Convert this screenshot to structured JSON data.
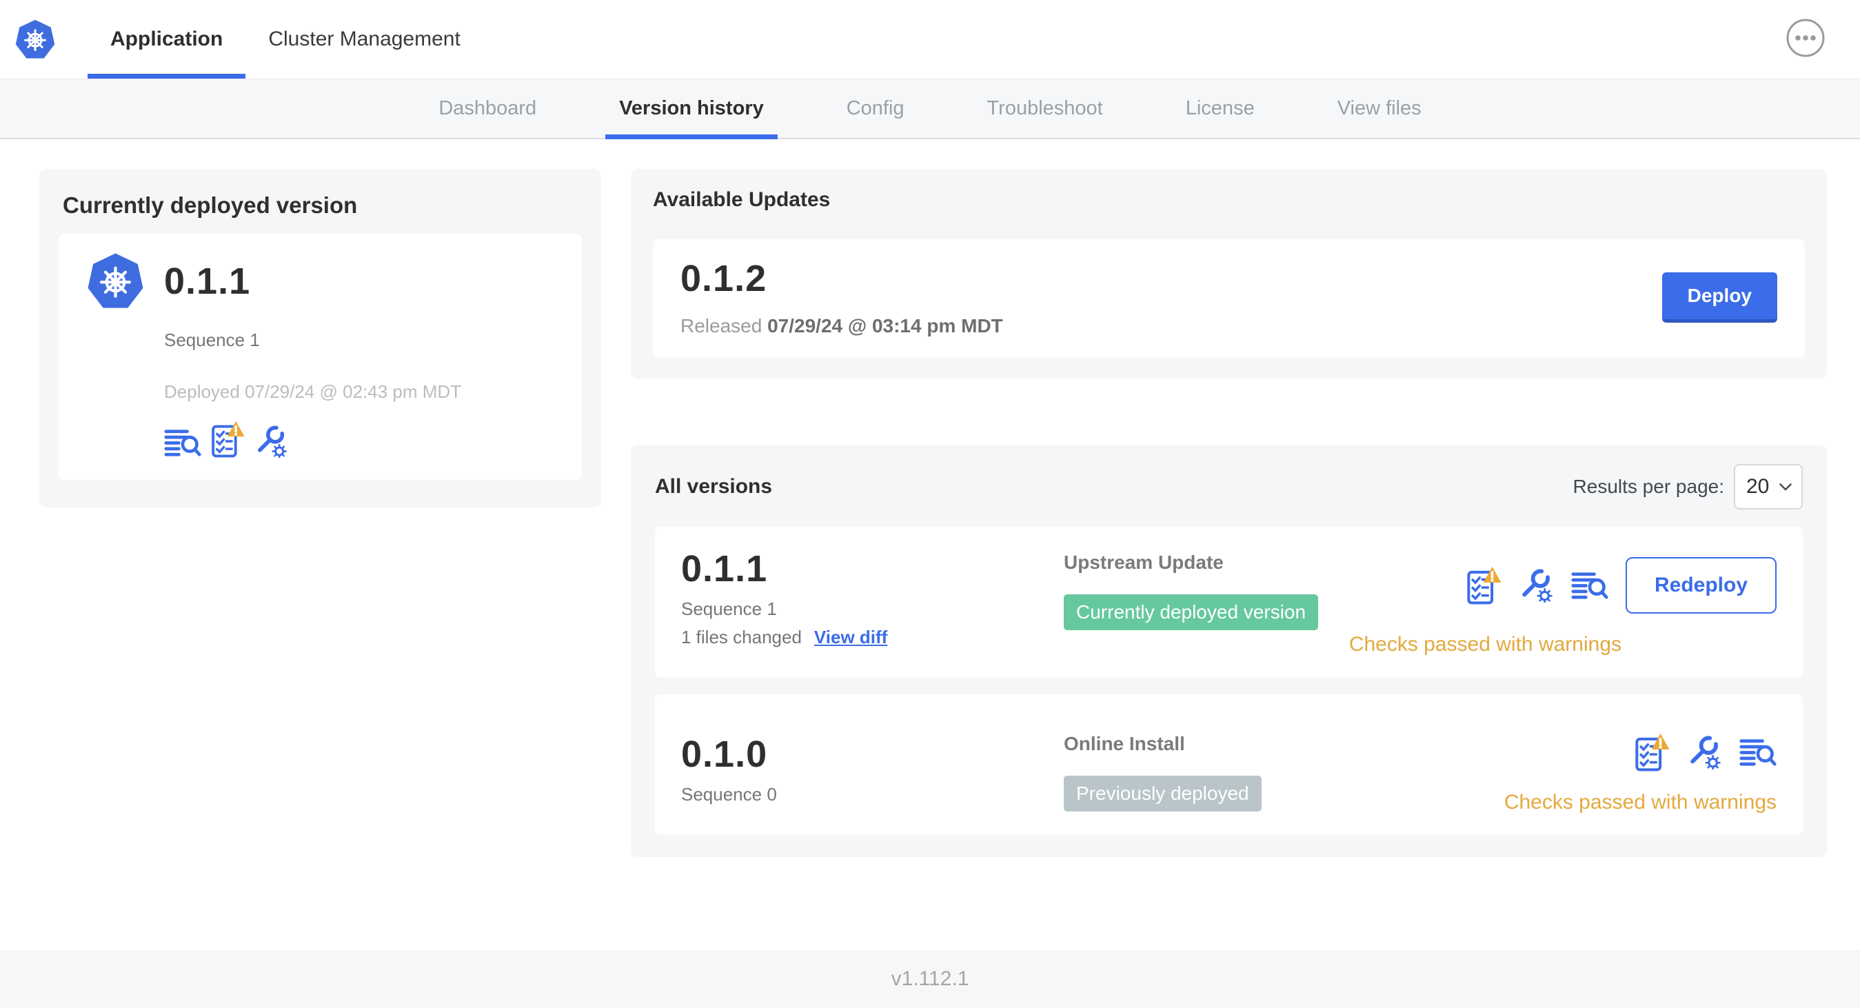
{
  "header": {
    "tabs": [
      {
        "label": "Application",
        "active": true
      },
      {
        "label": "Cluster Management",
        "active": false
      }
    ]
  },
  "subnav": {
    "tabs": [
      "Dashboard",
      "Version history",
      "Config",
      "Troubleshoot",
      "License",
      "View files"
    ],
    "active": "Version history"
  },
  "current_version_card": {
    "title": "Currently deployed version",
    "version": "0.1.1",
    "sequence": "Sequence 1",
    "deployed": "Deployed 07/29/24 @ 02:43 pm MDT",
    "icons": [
      "diff-icon",
      "preflight-checks-warning-icon",
      "config-icon"
    ]
  },
  "available_updates": {
    "title": "Available Updates",
    "version": "0.1.2",
    "released_label": "Released",
    "released_date": "07/29/24 @ 03:14 pm MDT",
    "deploy_button": "Deploy"
  },
  "all_versions": {
    "title": "All versions",
    "results_per_page_label": "Results per page:",
    "results_per_page": "20",
    "rows": [
      {
        "version": "0.1.1",
        "sequence": "Sequence 1",
        "files_changed": "1 files changed",
        "view_diff": "View diff",
        "source": "Upstream Update",
        "badge": "Currently deployed version",
        "badge_color": "#65c89e",
        "icons": [
          "preflight-checks-warning-icon",
          "config-icon",
          "diff-icon"
        ],
        "action": "Redeploy",
        "status": "Checks passed with warnings"
      },
      {
        "version": "0.1.0",
        "sequence": "Sequence 0",
        "source": "Online Install",
        "badge": "Previously deployed",
        "badge_color": "#b9c5c8",
        "icons": [
          "preflight-checks-warning-icon",
          "config-icon",
          "diff-icon"
        ],
        "status": "Checks passed with warnings"
      }
    ]
  },
  "footer": {
    "app_version": "v1.112.1"
  },
  "colors": {
    "accent_blue": "#3b6ce9",
    "kubernetes_blue": "#3f6de0",
    "warning_amber": "#e3a93e",
    "badge_green": "#65c89e",
    "badge_gray": "#b9c5c8",
    "card_background": "#f5f6f8"
  }
}
